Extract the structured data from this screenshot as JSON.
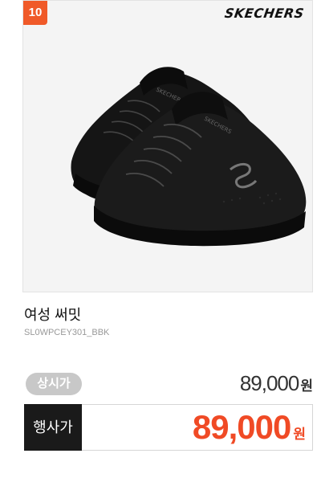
{
  "product": {
    "rank": "10",
    "brand": "SKECHERS",
    "name": "여성 써밋",
    "code": "SL0WPCEY301_BBK",
    "image_icon": "black-mesh-sneakers-image"
  },
  "pricing": {
    "regular_label": "상시가",
    "regular_price": "89,000",
    "regular_unit": "원",
    "sale_label": "행사가",
    "sale_price": "89,000",
    "sale_unit": "원"
  },
  "colors": {
    "badge": "#f05a29",
    "sale_price": "#f04a25",
    "sale_label_bg": "#1a1a1a",
    "regular_pill": "#c8c8c8"
  }
}
